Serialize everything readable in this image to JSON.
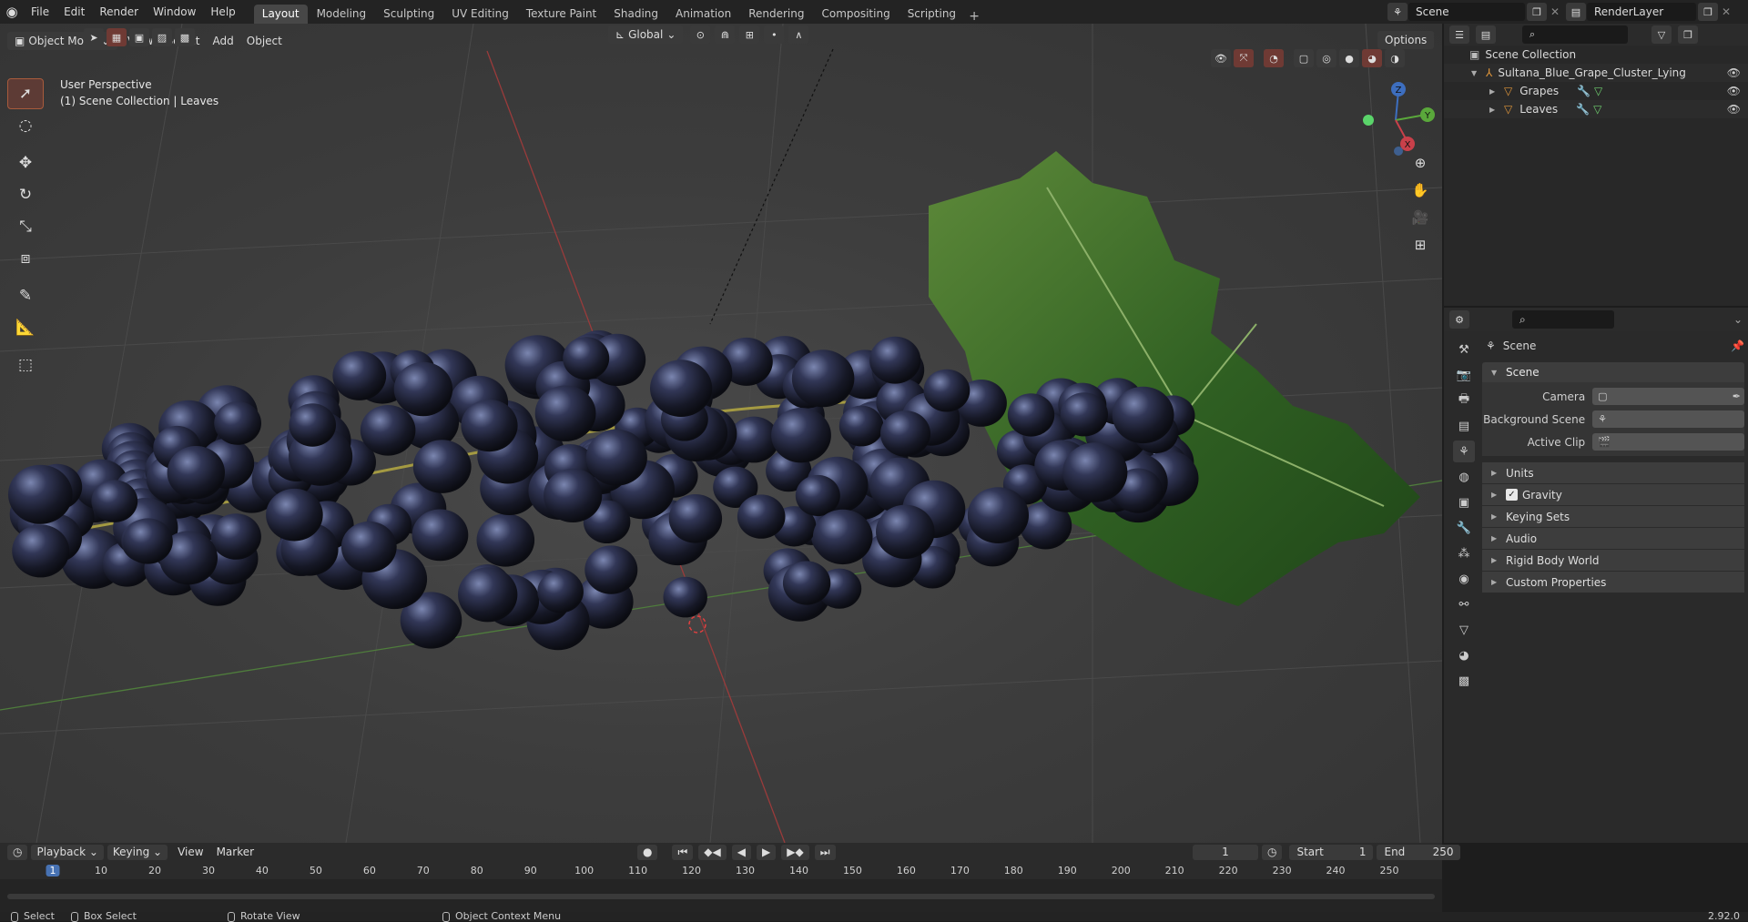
{
  "topbar": {
    "menus": [
      "File",
      "Edit",
      "Render",
      "Window",
      "Help"
    ],
    "workspaces": [
      "Layout",
      "Modeling",
      "Sculpting",
      "UV Editing",
      "Texture Paint",
      "Shading",
      "Animation",
      "Rendering",
      "Compositing",
      "Scripting"
    ],
    "active_workspace": "Layout",
    "scene": "Scene",
    "view_layer": "RenderLayer"
  },
  "viewport": {
    "mode": "Object Mode",
    "menus": [
      "View",
      "Select",
      "Add",
      "Object"
    ],
    "orientation": "Global",
    "options": "Options",
    "perspective": "User Perspective",
    "collection_info": "(1) Scene Collection | Leaves",
    "gizmo_axes": {
      "x": "X",
      "y": "Y",
      "z": "Z"
    }
  },
  "toolbar": {
    "tools": [
      "select-box",
      "cursor",
      "move",
      "rotate",
      "scale",
      "transform",
      "annotate",
      "measure",
      "add-cube"
    ],
    "active": "select-box"
  },
  "outliner": {
    "root": "Scene Collection",
    "items": [
      {
        "label": "Sultana_Blue_Grape_Cluster_Lying",
        "depth": 1
      },
      {
        "label": "Grapes",
        "depth": 2
      },
      {
        "label": "Leaves",
        "depth": 2
      }
    ]
  },
  "properties": {
    "context": "Scene",
    "panel": "Scene",
    "fields": [
      {
        "label": "Camera",
        "value": ""
      },
      {
        "label": "Background Scene",
        "value": ""
      },
      {
        "label": "Active Clip",
        "value": ""
      }
    ],
    "subpanels": [
      "Units",
      "Gravity",
      "Keying Sets",
      "Audio",
      "Rigid Body World",
      "Custom Properties"
    ],
    "gravity_checked": true
  },
  "timeline": {
    "menus": {
      "playback": "Playback",
      "keying": "Keying",
      "view": "View",
      "marker": "Marker"
    },
    "current_frame": "1",
    "start_label": "Start",
    "start": "1",
    "end_label": "End",
    "end": "250",
    "ticks": [
      "1",
      "10",
      "20",
      "30",
      "40",
      "50",
      "60",
      "70",
      "80",
      "90",
      "100",
      "110",
      "120",
      "130",
      "140",
      "150",
      "160",
      "170",
      "180",
      "190",
      "200",
      "210",
      "220",
      "230",
      "240",
      "250"
    ]
  },
  "statusbar": {
    "items": [
      "Select",
      "Box Select",
      "Rotate View",
      "Object Context Menu"
    ],
    "version": "2.92.0"
  }
}
